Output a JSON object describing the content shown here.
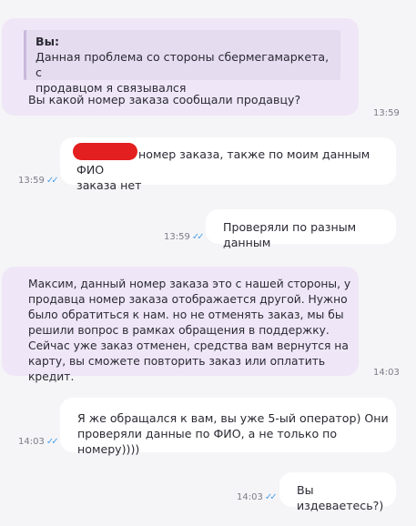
{
  "messages": [
    {
      "id": 1,
      "direction": "incoming",
      "quote": {
        "author": "Вы:",
        "text": "Данная проблема со стороны сбермегамаркета, с\nпродавцом я связывался"
      },
      "text": "Вы какой номер заказа сообщали продавцу?",
      "time": "13:59"
    },
    {
      "id": 2,
      "direction": "outgoing",
      "text": "номер заказа, также по моим данным ФИО\nзаказа нет",
      "redacted_prefix": true,
      "time": "13:59",
      "status": "read"
    },
    {
      "id": 3,
      "direction": "outgoing",
      "text": "Проверяли по разным данным",
      "time": "13:59",
      "status": "read"
    },
    {
      "id": 4,
      "direction": "incoming",
      "text": "Максим, данный номер заказа это с нашей стороны, у\nпродавца номер заказа отображается другой. Нужно\nбыло обратиться к нам. но не отменять заказ, мы бы\nрешили вопрос в рамках обращения в поддержку.\nСейчас уже заказ отменен, средства вам вернутся на\nкарту, вы сможете повторить заказ или оплатить кредит.",
      "time": "14:03"
    },
    {
      "id": 5,
      "direction": "outgoing",
      "text": "Я же обращался к вам, вы уже 5-ый оператор) Они\nпроверяли данные по ФИО, а не только по номеру))))",
      "time": "14:03",
      "status": "read"
    },
    {
      "id": 6,
      "direction": "outgoing",
      "text": "Вы издеваетесь?)",
      "time": "14:03",
      "status": "read"
    }
  ],
  "icons": {
    "read_status": "double-check-icon"
  },
  "colors": {
    "incoming_bubble": "#efe6f7",
    "outgoing_bubble": "#ffffff",
    "background": "#f5f5f7",
    "read_check": "#4a9fe8",
    "redaction": "#e31f1f"
  }
}
